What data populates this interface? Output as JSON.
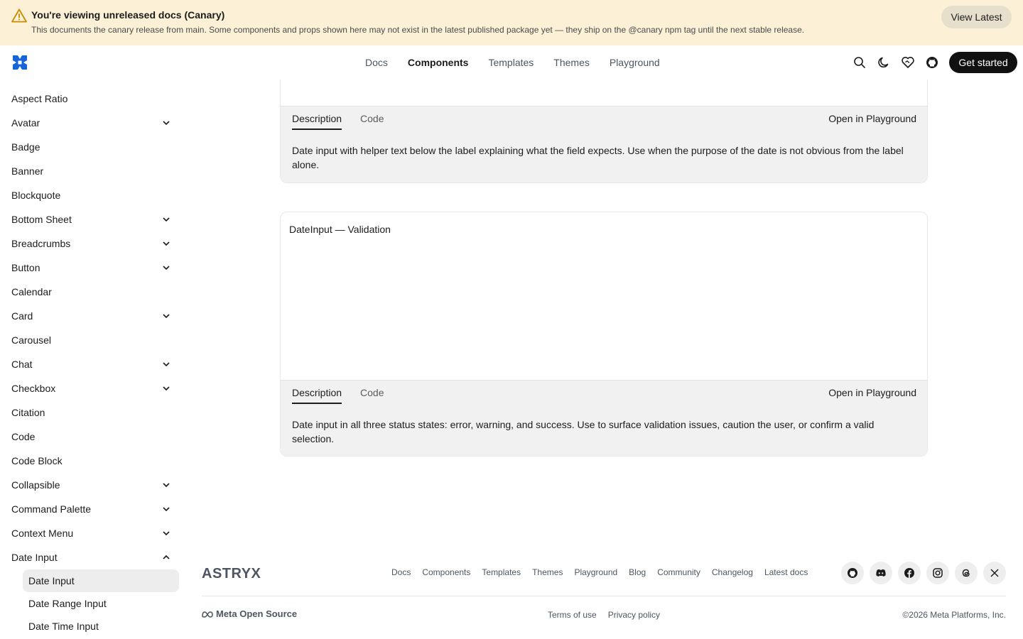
{
  "banner": {
    "title": "You're viewing unreleased docs (Canary)",
    "description": "This documents the canary release from main. Some components and props shown here may not exist in the latest published package yet — they ship on the @canary npm tag until the next stable release.",
    "view_latest_label": "View Latest"
  },
  "header": {
    "nav": [
      "Docs",
      "Components",
      "Templates",
      "Themes",
      "Playground"
    ],
    "active_nav": "Components",
    "get_started_label": "Get started"
  },
  "sidebar": {
    "items": [
      {
        "label": "Aspect Ratio",
        "expandable": false
      },
      {
        "label": "Avatar",
        "expandable": true
      },
      {
        "label": "Badge",
        "expandable": false
      },
      {
        "label": "Banner",
        "expandable": false
      },
      {
        "label": "Blockquote",
        "expandable": false
      },
      {
        "label": "Bottom Sheet",
        "expandable": true
      },
      {
        "label": "Breadcrumbs",
        "expandable": true
      },
      {
        "label": "Button",
        "expandable": true
      },
      {
        "label": "Calendar",
        "expandable": false
      },
      {
        "label": "Card",
        "expandable": true
      },
      {
        "label": "Carousel",
        "expandable": false
      },
      {
        "label": "Chat",
        "expandable": true
      },
      {
        "label": "Checkbox",
        "expandable": true
      },
      {
        "label": "Citation",
        "expandable": false
      },
      {
        "label": "Code",
        "expandable": false
      },
      {
        "label": "Code Block",
        "expandable": false
      },
      {
        "label": "Collapsible",
        "expandable": true
      },
      {
        "label": "Command Palette",
        "expandable": true
      },
      {
        "label": "Context Menu",
        "expandable": true
      },
      {
        "label": "Date Input",
        "expandable": true,
        "expanded": true
      }
    ],
    "subitems": [
      "Date Input",
      "Date Range Input",
      "Date Time Input"
    ],
    "active_subitem": "Date Input"
  },
  "examples": [
    {
      "title": "",
      "tabs": [
        "Description",
        "Code"
      ],
      "open_label": "Open in Playground",
      "description": "Date input with helper text below the label explaining what the field expects. Use when the purpose of the date is not obvious from the label alone."
    },
    {
      "title": "DateInput — Validation",
      "tabs": [
        "Description",
        "Code"
      ],
      "open_label": "Open in Playground",
      "description": "Date input in all three status states: error, warning, and success. Use to surface validation issues, caution the user, or confirm a valid selection."
    }
  ],
  "footer": {
    "logo_text": "ASTRYX",
    "nav": [
      "Docs",
      "Components",
      "Templates",
      "Themes",
      "Playground",
      "Blog",
      "Community",
      "Changelog",
      "Latest docs"
    ],
    "meta_label": "Meta Open Source",
    "legal": [
      "Terms of use",
      "Privacy policy"
    ],
    "copyright": "©2026 Meta Platforms, Inc.",
    "social_icons": [
      "github-icon",
      "discord-icon",
      "facebook-icon",
      "instagram-icon",
      "threads-icon",
      "x-icon"
    ]
  },
  "colors": {
    "banner_bg": "#fcf1d6",
    "accent_blue": "#1565d8",
    "primary_button": "#111111"
  }
}
